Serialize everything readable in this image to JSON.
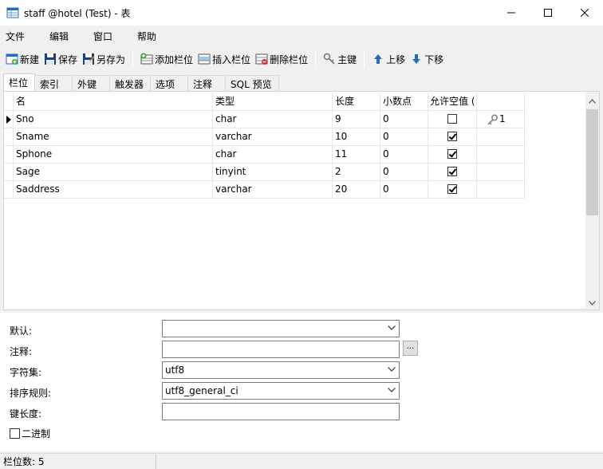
{
  "window": {
    "title": "staff @hotel (Test) - 表"
  },
  "menu": [
    "文件",
    "编辑",
    "窗口",
    "帮助"
  ],
  "toolbar": {
    "new": "新建",
    "save": "保存",
    "save_as": "另存为",
    "add_field": "添加栏位",
    "insert_field": "插入栏位",
    "delete_field": "删除栏位",
    "primary_key": "主键",
    "move_up": "上移",
    "move_down": "下移"
  },
  "tabs": [
    "栏位",
    "索引",
    "外键",
    "触发器",
    "选项",
    "注释",
    "SQL 预览"
  ],
  "grid": {
    "headers": [
      "名",
      "类型",
      "长度",
      "小数点",
      "允许空值 ("
    ],
    "rows": [
      {
        "name": "Sno",
        "type": "char",
        "length": "9",
        "decimals": "0",
        "nullable": false,
        "key": "1"
      },
      {
        "name": "Sname",
        "type": "varchar",
        "length": "10",
        "decimals": "0",
        "nullable": true,
        "key": ""
      },
      {
        "name": "Sphone",
        "type": "char",
        "length": "11",
        "decimals": "0",
        "nullable": true,
        "key": ""
      },
      {
        "name": "Sage",
        "type": "tinyint",
        "length": "2",
        "decimals": "0",
        "nullable": true,
        "key": ""
      },
      {
        "name": "Saddress",
        "type": "varchar",
        "length": "20",
        "decimals": "0",
        "nullable": true,
        "key": ""
      }
    ]
  },
  "properties": {
    "default_label": "默认:",
    "default_value": "",
    "comment_label": "注释:",
    "comment_value": "",
    "comment_button": "...",
    "charset_label": "字符集:",
    "charset_value": "utf8",
    "collation_label": "排序规则:",
    "collation_value": "utf8_general_ci",
    "key_length_label": "键长度:",
    "key_length_value": "",
    "binary_label": "二进制",
    "binary_checked": false
  },
  "status": {
    "field_count": "栏位数: 5"
  }
}
